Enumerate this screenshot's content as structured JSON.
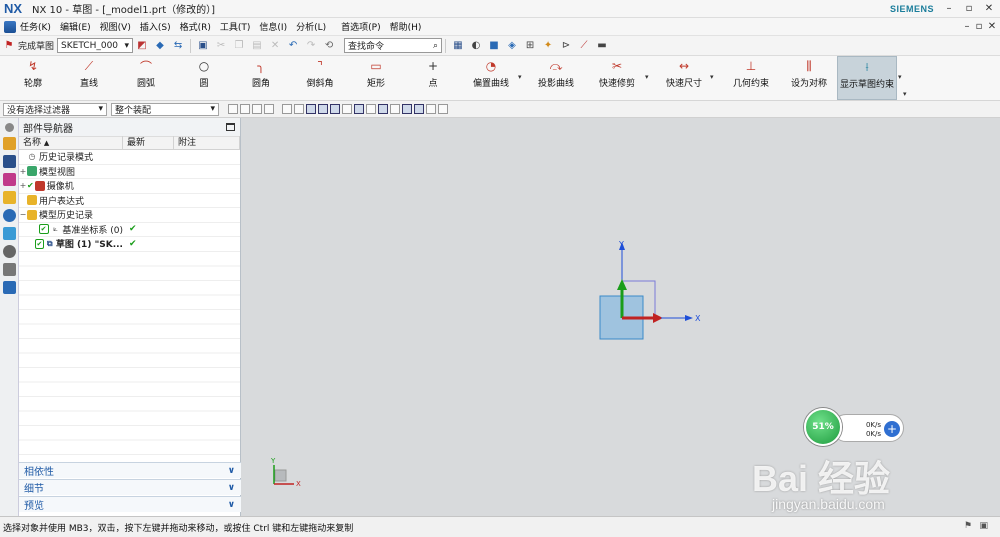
{
  "titlebar": {
    "logo": "NX",
    "title": "NX 10 - 草图 - [_model1.prt（修改的）]",
    "brand": "SIEMENS",
    "controls": {
      "minimize": "–",
      "restore": "▫",
      "close": "✕"
    }
  },
  "menubar": {
    "items": [
      "任务(K)",
      "编辑(E)",
      "视图(V)",
      "插入(S)",
      "格式(R)",
      "工具(T)",
      "信息(I)",
      "分析(L)",
      "首选项(P)",
      "帮助(H)"
    ],
    "controls": {
      "minimize": "–",
      "restore": "▫",
      "close": "✕"
    }
  },
  "toolbar": {
    "finish_sketch": "完成草图",
    "sketch_name": "SKETCH_000",
    "search_placeholder": "查找命令"
  },
  "ribbon": {
    "buttons": [
      {
        "label": "轮廓",
        "icon": "profile-icon"
      },
      {
        "label": "直线",
        "icon": "line-icon"
      },
      {
        "label": "圆弧",
        "icon": "arc-icon"
      },
      {
        "label": "圆",
        "icon": "circle-icon"
      },
      {
        "label": "圆角",
        "icon": "fillet-icon"
      },
      {
        "label": "倒斜角",
        "icon": "chamfer-icon"
      },
      {
        "label": "矩形",
        "icon": "rectangle-icon"
      },
      {
        "label": "点",
        "icon": "point-icon"
      },
      {
        "label": "偏置曲线",
        "icon": "offset-curve-icon"
      },
      {
        "label": "投影曲线",
        "icon": "project-curve-icon"
      },
      {
        "label": "快速修剪",
        "icon": "quick-trim-icon"
      },
      {
        "label": "快速尺寸",
        "icon": "rapid-dimension-icon"
      },
      {
        "label": "几何约束",
        "icon": "geometric-constraint-icon"
      },
      {
        "label": "设为对称",
        "icon": "make-symmetric-icon"
      },
      {
        "label": "显示草图约束",
        "icon": "show-constraints-icon"
      }
    ]
  },
  "filterbar": {
    "selection_filter": "没有选择过滤器",
    "assembly_scope": "整个装配"
  },
  "navigator": {
    "title": "部件导航器",
    "columns": [
      "名称",
      "最新",
      "附注"
    ],
    "rows": [
      {
        "toggle": "",
        "label": "历史记录模式",
        "latest": "",
        "bold": false
      },
      {
        "toggle": "+",
        "label": "模型视图",
        "latest": "",
        "bold": false
      },
      {
        "toggle": "+",
        "label": "摄像机",
        "latest": "",
        "bold": false
      },
      {
        "toggle": "",
        "label": "用户表达式",
        "latest": "",
        "bold": false
      },
      {
        "toggle": "−",
        "label": "模型历史记录",
        "latest": "",
        "bold": false
      },
      {
        "toggle": "",
        "label": "基准坐标系 (0)",
        "latest": "✔",
        "bold": false
      },
      {
        "toggle": "",
        "label": "草图 (1) \"SK...",
        "latest": "✔",
        "bold": true
      }
    ],
    "sections": [
      "相依性",
      "细节",
      "预览"
    ]
  },
  "graphics": {
    "axis_y": "Y",
    "axis_x": "X",
    "triad_y": "Y",
    "triad_x": "X"
  },
  "statusbar": {
    "text": "选择对象并使用 MB3，双击，按下左键并拖动来移动，或按住 Ctrl 键和左键拖动来复制"
  },
  "overlay": {
    "percent": "51%",
    "upload": "0K/s",
    "download": "0K/s",
    "watermark": "Bai 经验",
    "watermark_url": "jingyan.baidu.com"
  }
}
